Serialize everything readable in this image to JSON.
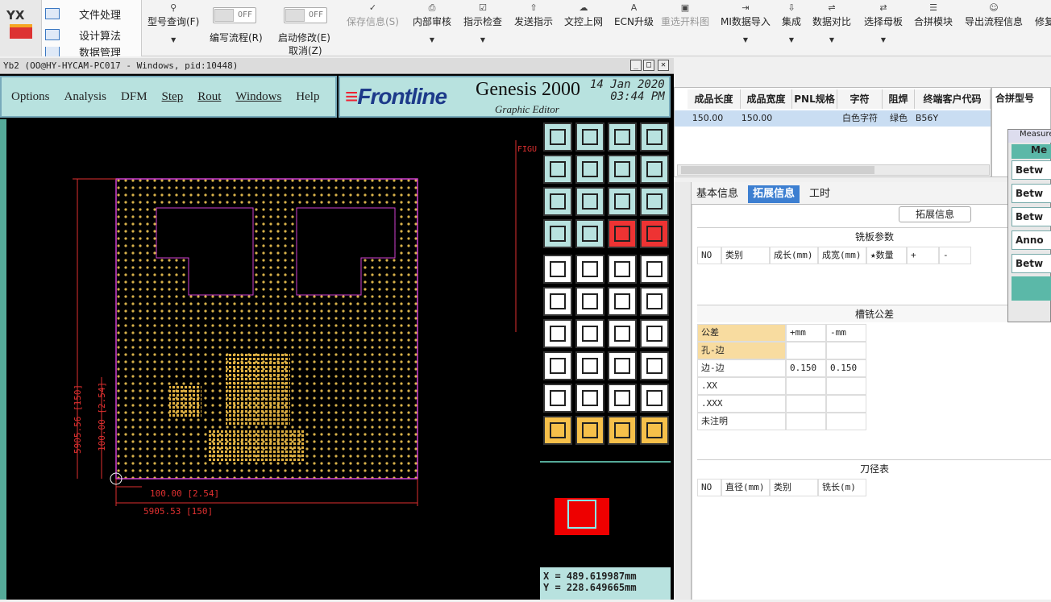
{
  "app": {
    "logo_text": "YX"
  },
  "sidenav": [
    "文件处理",
    "设计算法",
    "数据管理"
  ],
  "toolbar": [
    {
      "label": "型号查询(F)",
      "icon": "search-icon"
    },
    {
      "label": "编写流程(R)",
      "toggle": "OFF"
    },
    {
      "label": "启动修改(E)",
      "sub": "取消(Z)",
      "toggle": "OFF"
    },
    {
      "label": "保存信息(S)",
      "icon": "check-icon",
      "disabled": true
    },
    {
      "label": "内部审核",
      "icon": "print-icon"
    },
    {
      "label": "指示检查",
      "icon": "check-icon"
    },
    {
      "label": "发送指示",
      "icon": "upload-icon"
    },
    {
      "label": "文控上网",
      "icon": "cloud-icon"
    },
    {
      "label": "ECN升级",
      "icon": "font-icon"
    },
    {
      "label": "重选开料图",
      "icon": "image-icon",
      "disabled": true
    },
    {
      "label": "MI数据导入",
      "icon": "import-icon"
    },
    {
      "label": "集成",
      "icon": "download-icon"
    },
    {
      "label": "数据对比",
      "icon": "compare-icon"
    },
    {
      "label": "选择母板",
      "icon": "shuffle-icon"
    },
    {
      "label": "合拼模块",
      "icon": "list-icon"
    },
    {
      "label": "导出流程信息",
      "icon": "smile-icon"
    },
    {
      "label": "修复",
      "icon": ""
    }
  ],
  "genesis": {
    "title": "Yb2 (OO@HY-HYCAM-PC017 - Windows, pid:10448)",
    "menus": [
      "Options",
      "Analysis",
      "DFM",
      "Step",
      "Rout",
      "Windows",
      "Help"
    ],
    "brand": "Frontline",
    "product": "Genesis 2000",
    "subtitle": "Graphic Editor",
    "date": "14 Jan 2020",
    "time": "03:44 PM",
    "x_readout": "X = 489.619987mm",
    "y_readout": "Y = 228.649665mm",
    "dims": {
      "h_dim": "5905.53 [150]",
      "v_dim": "5905.56 [150]",
      "small_h": "100.00 [2.54]",
      "small_v": "100.00 [2.54]"
    },
    "fig_label": "FIGU"
  },
  "table": {
    "headers": [
      "成品长度",
      "成品宽度",
      "PNL规格",
      "字符",
      "阻焊",
      "终端客户代码"
    ],
    "row": [
      "150.00",
      "150.00",
      "",
      "白色字符",
      "绿色",
      "B56Y"
    ],
    "right_title": "合拼型号"
  },
  "tabs": [
    "基本信息",
    "拓展信息",
    "工时"
  ],
  "panel": {
    "group_title": "拓展信息",
    "milling_title": "铣板参数",
    "milling_headers": [
      "NO",
      "类别",
      "成长(mm)",
      "成宽(mm)",
      "★数量",
      "+",
      "-"
    ],
    "slot_title": "槽铣公差",
    "tol_headers": [
      "公差",
      "+mm",
      "-mm"
    ],
    "tol_rows": [
      [
        "孔-边",
        "",
        ""
      ],
      [
        "边-边",
        "0.150",
        "0.150"
      ],
      [
        ".XX",
        "",
        ""
      ],
      [
        ".XXX",
        "",
        ""
      ],
      [
        "未注明",
        "",
        ""
      ]
    ],
    "tool_title": "刀径表",
    "tool_headers": [
      "NO",
      "直径(mm)",
      "类别",
      "铣长(m)"
    ]
  },
  "measure": {
    "title": "Measure",
    "head": "Me",
    "items": [
      "Betw",
      "Betw",
      "Betw",
      "Anno",
      "Betw"
    ]
  }
}
